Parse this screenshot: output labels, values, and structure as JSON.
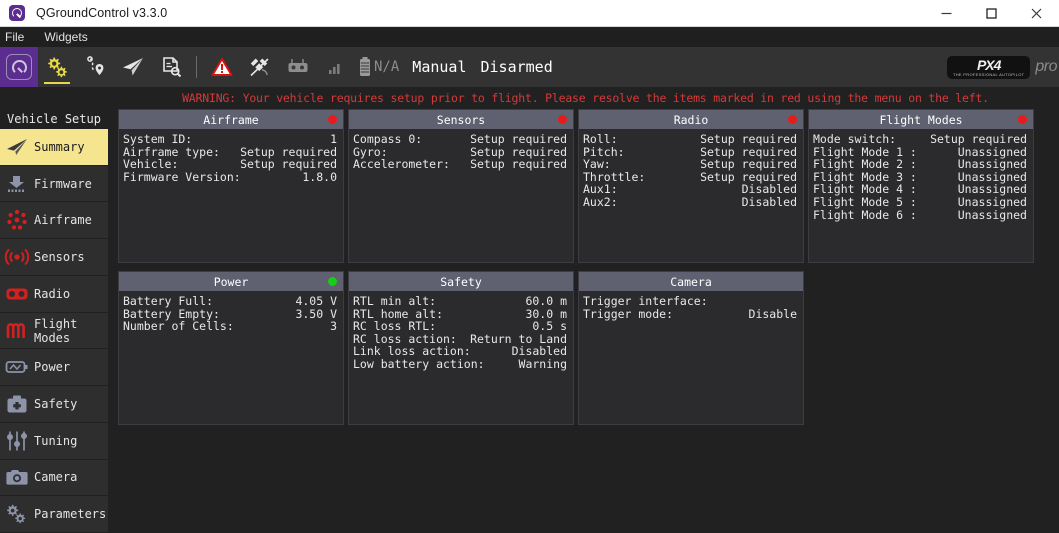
{
  "window": {
    "title": "QGroundControl v3.3.0",
    "app_icon": "qgroundcontrol-icon",
    "minimize_label": "─",
    "maximize_label": "□",
    "close_label": "✕"
  },
  "menubar": {
    "items": [
      {
        "label": "File"
      },
      {
        "label": "Widgets"
      }
    ]
  },
  "toolbar": {
    "home_icon": "qgc-home-icon",
    "buttons": [
      {
        "name": "setup",
        "icon": "gears-icon",
        "active": true
      },
      {
        "name": "plan",
        "icon": "waypoint-path-icon",
        "active": false
      },
      {
        "name": "fly",
        "icon": "paper-plane-icon",
        "active": false
      },
      {
        "name": "analyze",
        "icon": "document-search-icon",
        "active": false
      }
    ],
    "status": {
      "warning_icon": "warning-triangle-icon",
      "gps_icon": "satellite-no-signal-icon",
      "rc_icon": "rc-transmitter-icon",
      "telemetry_icon": "signal-bars-icon",
      "battery_icon": "battery-icon",
      "battery_value": "N/A",
      "flight_mode": "Manual",
      "armed_state": "Disarmed"
    },
    "brand": {
      "logo_main": "PX4",
      "logo_sub": "THE PROFESSIONAL AUTOPILOT",
      "logo_suffix": "pro"
    }
  },
  "warning": {
    "text": "WARNING: Your vehicle requires setup prior to flight. Please resolve the items marked in red using the menu on the left."
  },
  "sidebar": {
    "title": "Vehicle Setup",
    "items": [
      {
        "label": "Summary",
        "icon": "paper-plane-icon",
        "selected": true
      },
      {
        "label": "Firmware",
        "icon": "firmware-chip-icon",
        "selected": false
      },
      {
        "label": "Airframe",
        "icon": "airframe-rotor-icon",
        "selected": false
      },
      {
        "label": "Sensors",
        "icon": "sensors-waves-icon",
        "selected": false
      },
      {
        "label": "Radio",
        "icon": "radio-controller-icon",
        "selected": false
      },
      {
        "label": "Flight Modes",
        "icon": "flight-modes-icon",
        "selected": false
      },
      {
        "label": "Power",
        "icon": "power-battery-icon",
        "selected": false
      },
      {
        "label": "Safety",
        "icon": "safety-kit-icon",
        "selected": false
      },
      {
        "label": "Tuning",
        "icon": "tuning-sliders-icon",
        "selected": false
      },
      {
        "label": "Camera",
        "icon": "camera-icon",
        "selected": false
      },
      {
        "label": "Parameters",
        "icon": "gears-icon",
        "selected": false
      }
    ]
  },
  "panels": {
    "airframe": {
      "title": "Airframe",
      "status": "red",
      "rows": [
        {
          "key": "System ID:",
          "value": "1"
        },
        {
          "key": "Airframe type:",
          "value": "Setup required"
        },
        {
          "key": "Vehicle:",
          "value": "Setup required"
        },
        {
          "key": "Firmware Version:",
          "value": "1.8.0"
        }
      ]
    },
    "sensors": {
      "title": "Sensors",
      "status": "red",
      "rows": [
        {
          "key": "Compass 0:",
          "value": "Setup required"
        },
        {
          "key": "Gyro:",
          "value": "Setup required"
        },
        {
          "key": "Accelerometer:",
          "value": "Setup required"
        }
      ]
    },
    "radio": {
      "title": "Radio",
      "status": "red",
      "rows": [
        {
          "key": "Roll:",
          "value": "Setup required"
        },
        {
          "key": "Pitch:",
          "value": "Setup required"
        },
        {
          "key": "Yaw:",
          "value": "Setup required"
        },
        {
          "key": "Throttle:",
          "value": "Setup required"
        },
        {
          "key": "Aux1:",
          "value": "Disabled"
        },
        {
          "key": "Aux2:",
          "value": "Disabled"
        }
      ]
    },
    "flight_modes": {
      "title": "Flight Modes",
      "status": "red",
      "rows": [
        {
          "key": "Mode switch:",
          "value": "Setup required"
        },
        {
          "key": "Flight Mode 1 :",
          "value": "Unassigned"
        },
        {
          "key": "Flight Mode 2 :",
          "value": "Unassigned"
        },
        {
          "key": "Flight Mode 3 :",
          "value": "Unassigned"
        },
        {
          "key": "Flight Mode 4 :",
          "value": "Unassigned"
        },
        {
          "key": "Flight Mode 5 :",
          "value": "Unassigned"
        },
        {
          "key": "Flight Mode 6 :",
          "value": "Unassigned"
        }
      ]
    },
    "power": {
      "title": "Power",
      "status": "green",
      "rows": [
        {
          "key": "Battery Full:",
          "value": "4.05 V"
        },
        {
          "key": "Battery Empty:",
          "value": "3.50 V"
        },
        {
          "key": "Number of Cells:",
          "value": "3"
        }
      ]
    },
    "safety": {
      "title": "Safety",
      "status": "none",
      "rows": [
        {
          "key": "RTL min alt:",
          "value": "60.0 m"
        },
        {
          "key": "RTL home alt:",
          "value": "30.0 m"
        },
        {
          "key": "RC loss RTL:",
          "value": "0.5 s"
        },
        {
          "key": "RC loss action:",
          "value": "Return to Land"
        },
        {
          "key": "Link loss action:",
          "value": "Disabled"
        },
        {
          "key": "Low battery action:",
          "value": "Warning"
        }
      ]
    },
    "camera": {
      "title": "Camera",
      "status": "none",
      "rows": [
        {
          "key": "Trigger interface:",
          "value": ""
        },
        {
          "key": "Trigger mode:",
          "value": "Disable"
        }
      ]
    }
  },
  "colors": {
    "accent_yellow": "#f5e58f",
    "warning_red": "#d43a3a",
    "status_red": "#e81b1b",
    "status_green": "#19cc19",
    "panel_header": "#5f6070",
    "background": "#212121"
  }
}
